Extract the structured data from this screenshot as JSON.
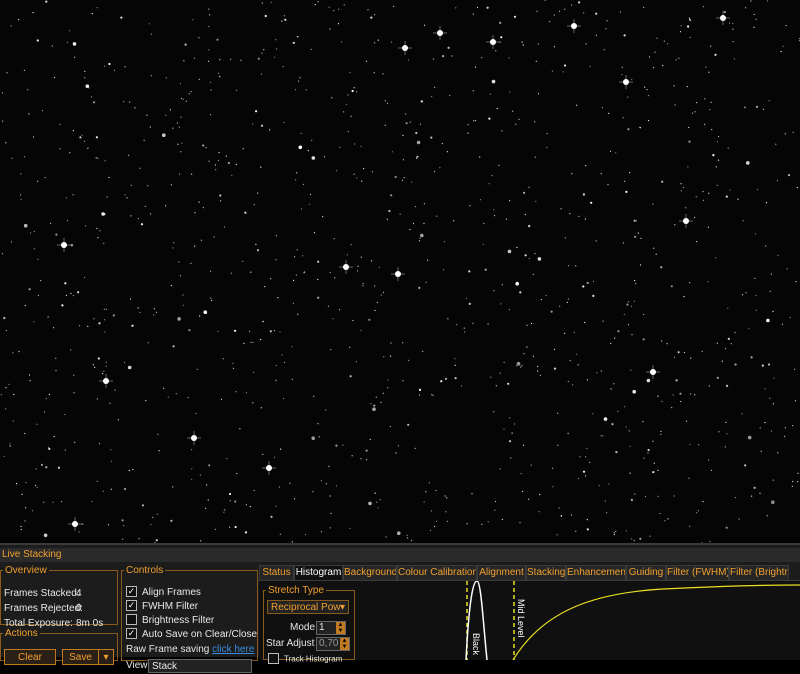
{
  "panel": {
    "title": "Live Stacking"
  },
  "overview": {
    "legend": "Overview",
    "rows": [
      {
        "label": "Frames Stacked:",
        "value": "4"
      },
      {
        "label": "Frames Rejected:",
        "value": "0"
      },
      {
        "label": "Total Exposure:",
        "value": "8m 0s"
      }
    ]
  },
  "actions": {
    "legend": "Actions",
    "clear_label": "Clear",
    "save_label": "Save",
    "dropdown_arrow": "▾"
  },
  "controls": {
    "legend": "Controls",
    "checkboxes": [
      {
        "label": "Align Frames",
        "checked": true
      },
      {
        "label": "FWHM Filter",
        "checked": true
      },
      {
        "label": "Brightness Filter",
        "checked": false
      },
      {
        "label": "Auto Save on Clear/Close",
        "checked": true
      }
    ],
    "raw_frame_text": "Raw Frame saving",
    "raw_frame_link": "click here",
    "view_label": "View",
    "view_value": "Stack"
  },
  "tabs": [
    {
      "label": "Status",
      "active": false
    },
    {
      "label": "Histogram",
      "active": true
    },
    {
      "label": "Background",
      "active": false
    },
    {
      "label": "Colour Calibration",
      "active": false
    },
    {
      "label": "Alignment",
      "active": false
    },
    {
      "label": "Stacking",
      "active": false
    },
    {
      "label": "Enhancement",
      "active": false
    },
    {
      "label": "Guiding",
      "active": false
    },
    {
      "label": "Filter (FWHM)",
      "active": false
    },
    {
      "label": "Filter (Brightne",
      "active": false
    }
  ],
  "histogram": {
    "stretch_legend": "Stretch Type",
    "stretch_value": "Reciprocal Pow",
    "mode_label": "Mode",
    "mode_value": "1",
    "star_adjust_label": "Star Adjust",
    "star_adjust_value": "0,70",
    "track_label": "Track Histogram",
    "black_label": "Black",
    "mid_label": "Mid Level",
    "curve_color": "#e8e020",
    "marker_color": "#e8e020"
  },
  "colors": {
    "accent": "#f0a030",
    "background": "#000000"
  }
}
